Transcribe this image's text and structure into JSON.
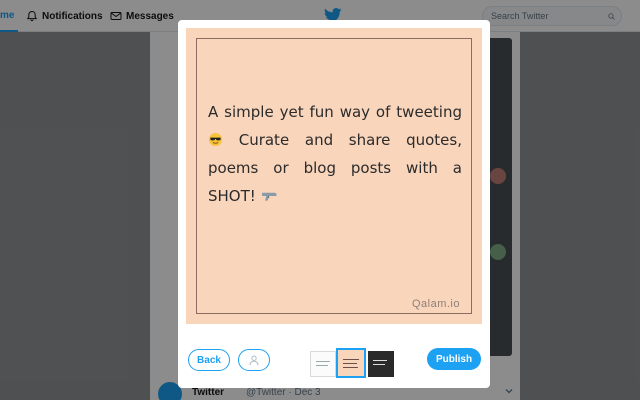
{
  "header": {
    "nav": {
      "home_label": "me",
      "notifications_label": "Notifications",
      "messages_label": "Messages"
    },
    "search": {
      "placeholder": "Search Twitter"
    },
    "brand_color": "#1da1f2"
  },
  "feed": {
    "tweet": {
      "name": "Twitter",
      "handle": "@Twitter · Dec 3"
    }
  },
  "modal": {
    "quote": {
      "line1": "A simple yet fun way of tweeting",
      "line2": "Curate and share quotes, poems or blog posts with a SHOT!",
      "emoji_1": "sunglasses-face",
      "emoji_2": "pistol",
      "watermark": "Qalam.io",
      "background_color": "#f9d5bc"
    },
    "footer": {
      "back_label": "Back",
      "publish_label": "Publish",
      "themes": [
        "white",
        "peach",
        "dark"
      ],
      "selected_theme": "peach"
    }
  }
}
